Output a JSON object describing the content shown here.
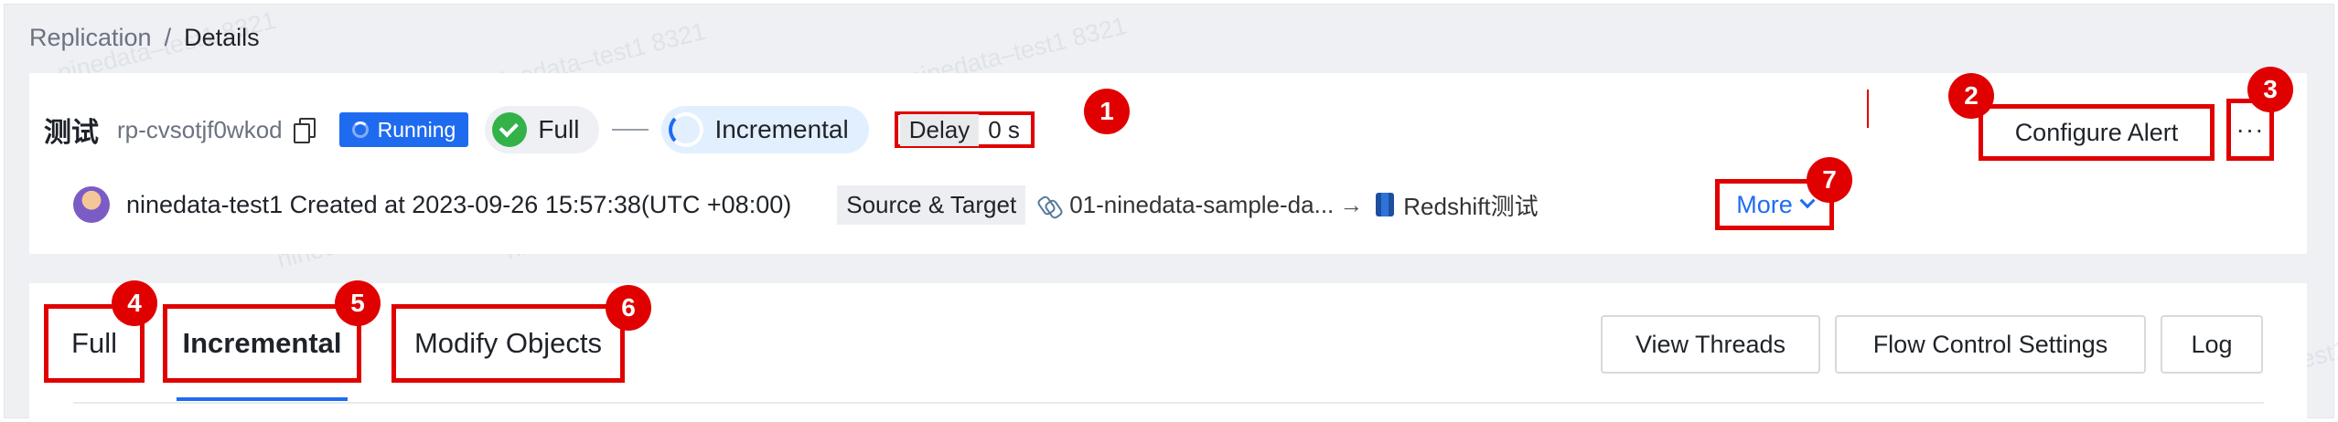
{
  "breadcrumb": {
    "parent": "Replication",
    "separator": "/",
    "current": "Details"
  },
  "watermark_text": "ninedata–test1 8321",
  "task": {
    "name": "测试",
    "id": "rp-cvsotjf0wkod",
    "status": "Running",
    "full_label": "Full",
    "incremental_label": "Incremental",
    "delay_label": "Delay",
    "delay_value": "0 s"
  },
  "meta": {
    "creator_text": "ninedata-test1 Created at 2023-09-26 15:57:38(UTC +08:00)",
    "source_target_label": "Source & Target",
    "source": "01-ninedata-sample-da...",
    "arrow": "→",
    "target": "Redshift测试",
    "more_label": "More"
  },
  "header_actions": {
    "configure_alert": "Configure Alert",
    "more_actions": "···"
  },
  "tabs": [
    {
      "label": "Full"
    },
    {
      "label": "Incremental",
      "active": true
    },
    {
      "label": "Modify Objects"
    }
  ],
  "buttons": {
    "view_threads": "View Threads",
    "flow_control": "Flow Control Settings",
    "log": "Log"
  },
  "markers": [
    "1",
    "2",
    "3",
    "4",
    "5",
    "6",
    "7"
  ],
  "colors": {
    "accent": "#1f6bf0",
    "success": "#33b24a",
    "annotation": "#e00000"
  }
}
